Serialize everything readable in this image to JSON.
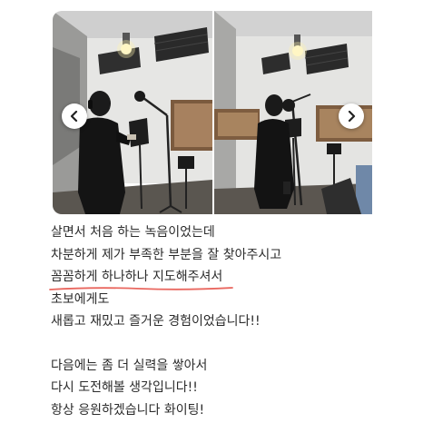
{
  "carousel": {
    "photos": [
      {
        "icon": "recording-studio-photo-1"
      },
      {
        "icon": "recording-studio-photo-2"
      }
    ],
    "prev_icon": "chevron-left-icon",
    "next_icon": "chevron-right-icon"
  },
  "review": {
    "lines": [
      "살면서 처음 하는 녹음이었는데",
      "차분하게 제가 부족한 부분을 잘 찾아주시고",
      "꼼꼼하게 하나하나 지도해주셔서",
      "초보에게도",
      "새롭고 재밌고 즐거운 경험이었습니다!!",
      "",
      "다음에는 좀 더 실력을 쌓아서",
      "다시 도전해볼 생각입니다!!",
      "항상 응원하겠습니다 화이팅!"
    ],
    "highlight_color": "#e9675f",
    "text_color": "#2b2b2b"
  }
}
